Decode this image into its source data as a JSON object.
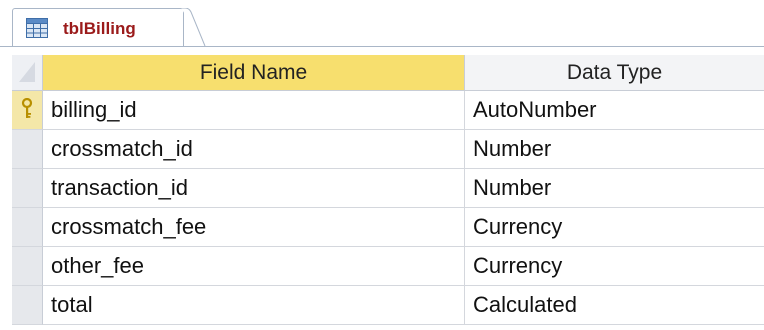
{
  "tab": {
    "label": "tblBilling",
    "icon": "table-icon"
  },
  "columns": {
    "field_name": "Field Name",
    "data_type": "Data Type"
  },
  "rows": [
    {
      "field_name": "billing_id",
      "data_type": "AutoNumber",
      "primary_key": true
    },
    {
      "field_name": "crossmatch_id",
      "data_type": "Number",
      "primary_key": false
    },
    {
      "field_name": "transaction_id",
      "data_type": "Number",
      "primary_key": false
    },
    {
      "field_name": "crossmatch_fee",
      "data_type": "Currency",
      "primary_key": false
    },
    {
      "field_name": "other_fee",
      "data_type": "Currency",
      "primary_key": false
    },
    {
      "field_name": "total",
      "data_type": "Calculated",
      "primary_key": false
    }
  ],
  "colors": {
    "header_accent": "#f7df6e",
    "tab_text": "#9b1b1b",
    "key_icon": "#d9b000"
  }
}
